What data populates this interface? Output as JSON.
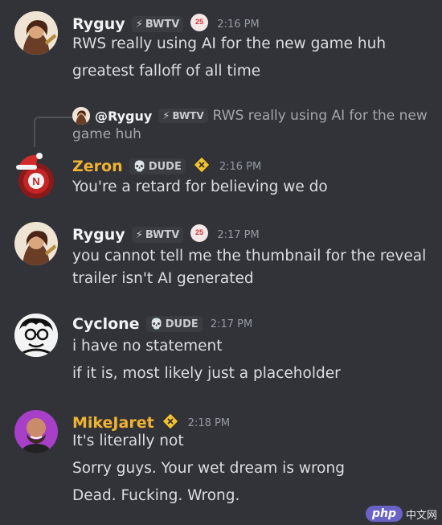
{
  "messages": [
    {
      "user": "Ryguy",
      "tag": "BWTV",
      "time": "2:16 PM",
      "lines": [
        "RWS really using AI for the new game huh",
        "greatest falloff of all time"
      ]
    },
    {
      "reply": {
        "user": "@Ryguy",
        "tag": "BWTV",
        "text1": "RWS really using AI for the new",
        "text2": "game huh"
      },
      "user": "Zeron",
      "tag": "DUDE",
      "time": "2:16 PM",
      "lines": [
        "You're a retard for believing we do"
      ],
      "name_color": "#f0b232"
    },
    {
      "user": "Ryguy",
      "tag": "BWTV",
      "time": "2:17 PM",
      "lines": [
        "you cannot tell me the thumbnail for the reveal",
        "trailer isn't AI generated"
      ]
    },
    {
      "user": "Cyclone",
      "tag": "DUDE",
      "time": "2:17 PM",
      "lines": [
        "i have no statement",
        "if it is, most likely just a placeholder"
      ]
    },
    {
      "user": "MikeJaret",
      "time": "2:18 PM",
      "lines": [
        "It's literally not",
        "Sorry guys. Your wet dream is wrong",
        "Dead. Fucking. Wrong."
      ],
      "name_color": "#f0b232"
    }
  ],
  "watermark": {
    "brand": "php",
    "site": "中文网"
  },
  "colors": {
    "background": "#313338",
    "text": "#dbdee1",
    "timestamp": "#949ba4",
    "gold_name": "#f0b232",
    "zeron_name": "#f0b232"
  },
  "icons": [
    "lightning-icon",
    "skull-icon",
    "crossing-sign-icon",
    "badge-25-icon",
    "santa-hat-icon"
  ]
}
